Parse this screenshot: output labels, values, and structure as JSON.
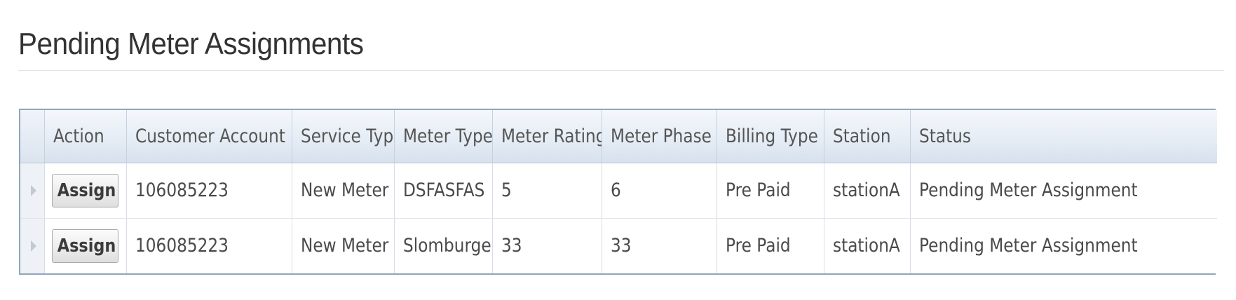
{
  "page": {
    "title": "Pending Meter Assignments"
  },
  "table": {
    "columns": [
      "Action",
      "Customer Account ID",
      "Service Type",
      "Meter Type",
      "Meter Rating",
      "Meter Phase",
      "Billing Type",
      "Station",
      "Status"
    ],
    "rows": [
      {
        "action_label": "Assign",
        "customer_account_id": "106085223",
        "service_type": "New Meter",
        "meter_type": "DSFASFAS",
        "meter_rating": "5",
        "meter_phase": "6",
        "billing_type": "Pre Paid",
        "station": "stationA",
        "status": "Pending Meter Assignment"
      },
      {
        "action_label": "Assign",
        "customer_account_id": "106085223",
        "service_type": "New Meter",
        "meter_type": "Slomburger",
        "meter_rating": "33",
        "meter_phase": "33",
        "billing_type": "Pre Paid",
        "station": "stationA",
        "status": "Pending Meter Assignment"
      }
    ]
  },
  "colors": {
    "header_gradient_top": "#f4f7fb",
    "header_gradient_bottom": "#d6e1ee",
    "grid_border": "#8fa6be"
  },
  "icons": {
    "row_indicator": "row-expand-arrow-icon"
  }
}
